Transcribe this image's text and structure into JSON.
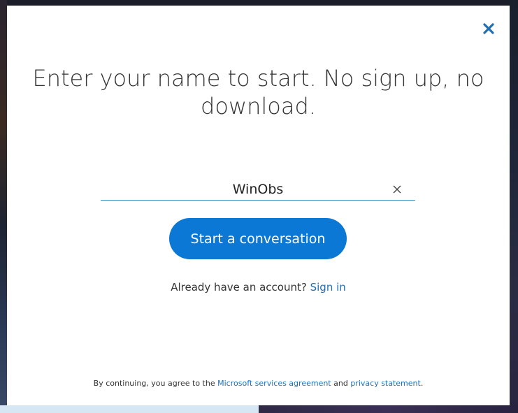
{
  "dialog": {
    "close_icon": "close-icon",
    "title": "Enter your name to start. No sign up, no download.",
    "name_input": {
      "value": "WinObs"
    },
    "clear_icon": "clear-icon",
    "start_button_label": "Start a conversation",
    "signin": {
      "prompt": "Already have an account?",
      "link_label": "Sign in"
    },
    "legal": {
      "prefix": "By continuing, you agree to the",
      "services_link": "Microsoft services agreement",
      "and": "and",
      "privacy_link": "privacy statement",
      "suffix": "."
    }
  },
  "colors": {
    "accent": "#0a78d4",
    "link": "#1f6fb5",
    "close_icon": "#1f6fb5"
  }
}
